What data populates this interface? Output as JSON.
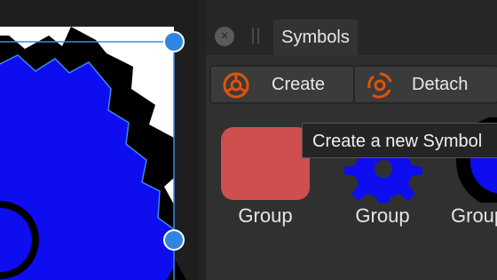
{
  "panel": {
    "close_icon": "×",
    "tab_label": "Symbols",
    "create_label": "Create",
    "detach_label": "Detach",
    "tooltip": "Create a new Symbol",
    "symbols": [
      {
        "label": "Group"
      },
      {
        "label": "Group"
      },
      {
        "label": "Group"
      }
    ]
  },
  "colors": {
    "gear_fill": "#0d0df0",
    "handle": "#2f86e0",
    "symbol_red": "#cf4e4e",
    "icon_orange": "#e0520b"
  },
  "icons": [
    "close-icon",
    "create-symbol-icon",
    "detach-symbol-icon"
  ]
}
